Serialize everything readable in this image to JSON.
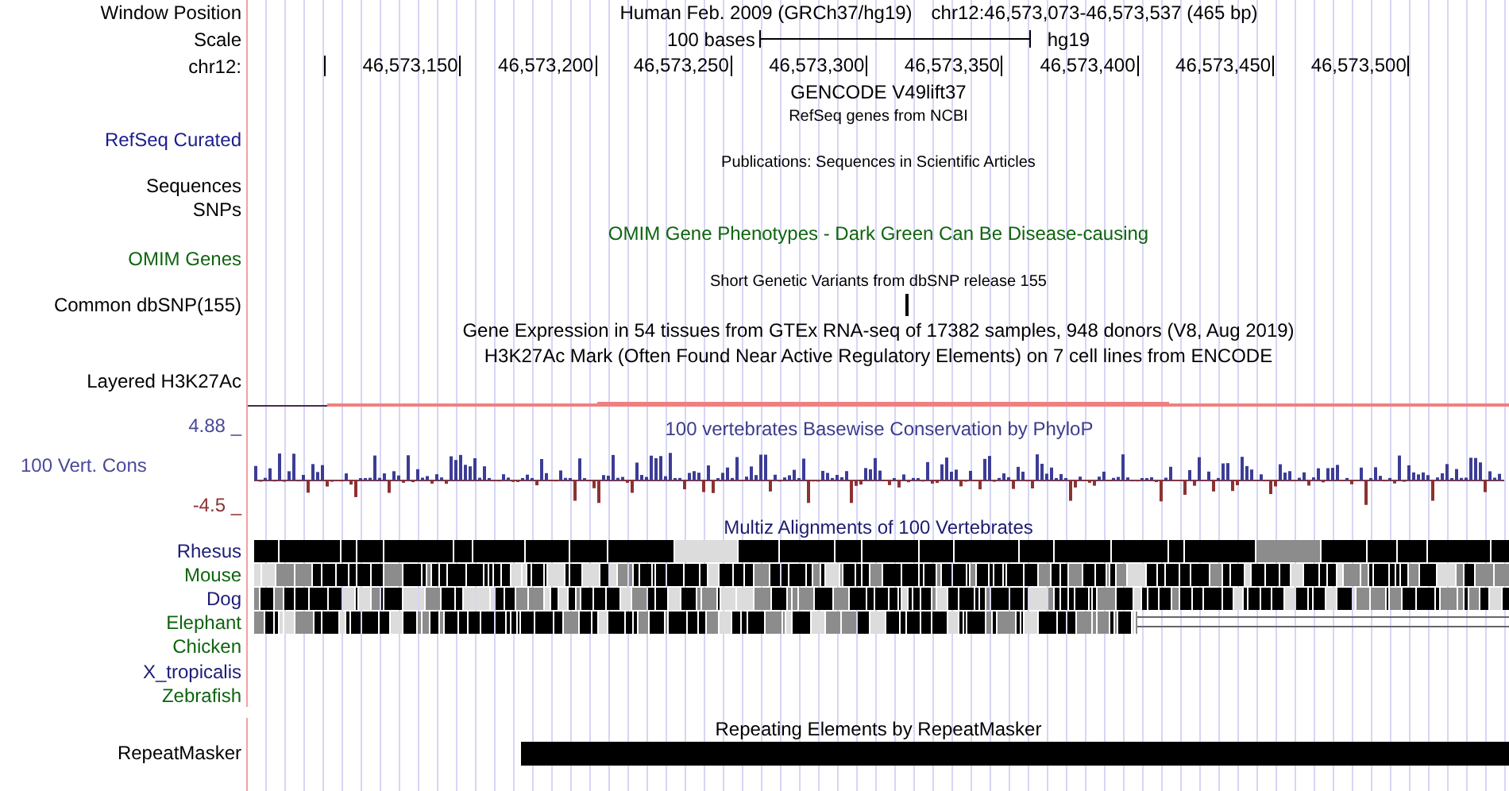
{
  "header": {
    "label": "Window Position",
    "title": "Human Feb. 2009 (GRCh37/hg19)",
    "position": "chr12:46,573,073-46,573,537 (465 bp)"
  },
  "scale": {
    "label": "Scale",
    "bar_text": "100 bases",
    "assembly": "hg19"
  },
  "ruler": {
    "label": "chr12:",
    "ticks": [
      "46,573,150",
      "46,573,200",
      "46,573,250",
      "46,573,300",
      "46,573,350",
      "46,573,400",
      "46,573,450",
      "46,573,500"
    ]
  },
  "tracks": [
    {
      "kind": "title",
      "title": "GENCODE V49lift37",
      "color": "#000000"
    },
    {
      "kind": "small",
      "title": "RefSeq genes from NCBI",
      "color": "#000000"
    },
    {
      "kind": "label",
      "label": "RefSeq Curated",
      "color": "#1c1c8c"
    },
    {
      "kind": "small",
      "title": "Publications: Sequences in Scientific Articles",
      "color": "#000000"
    },
    {
      "kind": "label",
      "label": "Sequences",
      "color": "#000000"
    },
    {
      "kind": "label",
      "label": "SNPs",
      "color": "#000000"
    },
    {
      "kind": "title",
      "title": "OMIM Gene Phenotypes - Dark Green Can Be Disease-causing",
      "color": "#0f640f"
    },
    {
      "kind": "label",
      "label": "OMIM Genes",
      "color": "#0f640f"
    },
    {
      "kind": "small",
      "title": "Short Genetic Variants from dbSNP release 155",
      "color": "#000000"
    },
    {
      "kind": "snp",
      "label": "Common dbSNP(155)",
      "color": "#000000"
    },
    {
      "kind": "title",
      "title": "Gene Expression in 54 tissues from GTEx RNA-seq of 17382 samples, 948 donors (V8, Aug 2019)",
      "color": "#000000"
    },
    {
      "kind": "title",
      "title": "H3K27Ac Mark (Often Found Near Active Regulatory Elements) on 7 cell lines from ENCODE",
      "color": "#000000"
    },
    {
      "kind": "label",
      "label": "Layered H3K27Ac",
      "color": "#000000"
    },
    {
      "kind": "signal",
      "color": "#f08080"
    }
  ],
  "conservation": {
    "label": "100 Vert. Cons",
    "title": "100 vertebrates Basewise Conservation by PhyloP",
    "max": "4.88 _",
    "min": "-4.5 _"
  },
  "multiz": {
    "title": "Multiz Alignments of 100 Vertebrates",
    "species": [
      {
        "name": "Rhesus",
        "color": "#1c1c78",
        "kind": "aligned"
      },
      {
        "name": "Mouse",
        "color": "#0f640f",
        "kind": "aligned"
      },
      {
        "name": "Dog",
        "color": "#1c1c78",
        "kind": "aligned"
      },
      {
        "name": "Elephant",
        "color": "#0f640f",
        "kind": "partial"
      },
      {
        "name": "Chicken",
        "color": "#0f640f",
        "kind": "none"
      },
      {
        "name": "X_tropicalis",
        "color": "#1c1c78",
        "kind": "none"
      },
      {
        "name": "Zebrafish",
        "color": "#0f640f",
        "kind": "none"
      }
    ]
  },
  "repeats": {
    "title": "Repeating Elements by RepeatMasker",
    "label": "RepeatMasker"
  }
}
